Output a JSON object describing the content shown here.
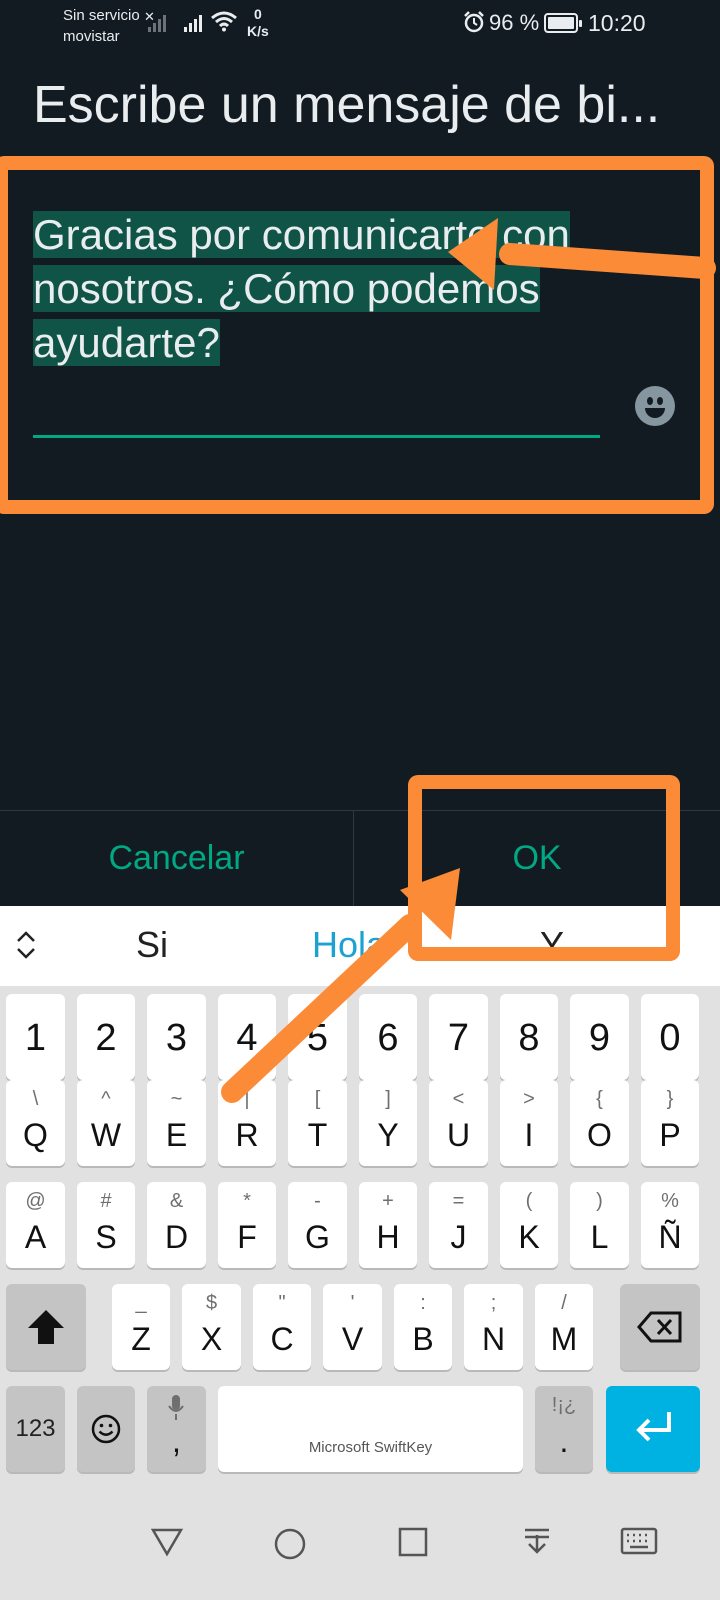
{
  "status_bar": {
    "carrier_line1": "Sin servicio",
    "carrier_line2": "movistar",
    "speed_value": "0",
    "speed_unit": "K/s",
    "battery_text": "96 %",
    "time": "10:20",
    "battery_level_percent": 96
  },
  "dialog": {
    "title": "Escribe un mensaje de bi...",
    "message_value": "Gracias por comunicarte con nosotros. ¿Cómo podemos ayudarte?",
    "cancel_label": "Cancelar",
    "ok_label": "OK"
  },
  "keyboard": {
    "suggestions": [
      "Si",
      "Hola",
      "Y"
    ],
    "number_row": [
      "1",
      "2",
      "3",
      "4",
      "5",
      "6",
      "7",
      "8",
      "9",
      "0"
    ],
    "row1": [
      {
        "main": "Q",
        "sec": "\\"
      },
      {
        "main": "W",
        "sec": "^"
      },
      {
        "main": "E",
        "sec": "~"
      },
      {
        "main": "R",
        "sec": "|"
      },
      {
        "main": "T",
        "sec": "["
      },
      {
        "main": "Y",
        "sec": "]"
      },
      {
        "main": "U",
        "sec": "<"
      },
      {
        "main": "I",
        "sec": ">"
      },
      {
        "main": "O",
        "sec": "{"
      },
      {
        "main": "P",
        "sec": "}"
      }
    ],
    "row2": [
      {
        "main": "A",
        "sec": "@"
      },
      {
        "main": "S",
        "sec": "#"
      },
      {
        "main": "D",
        "sec": "&"
      },
      {
        "main": "F",
        "sec": "*"
      },
      {
        "main": "G",
        "sec": "-"
      },
      {
        "main": "H",
        "sec": "+"
      },
      {
        "main": "J",
        "sec": "="
      },
      {
        "main": "K",
        "sec": "("
      },
      {
        "main": "L",
        "sec": ")"
      },
      {
        "main": "Ñ",
        "sec": "%"
      }
    ],
    "row3": [
      {
        "main": "Z",
        "sec": "_"
      },
      {
        "main": "X",
        "sec": "$"
      },
      {
        "main": "C",
        "sec": "\""
      },
      {
        "main": "V",
        "sec": "'"
      },
      {
        "main": "B",
        "sec": ":"
      },
      {
        "main": "N",
        "sec": ";"
      },
      {
        "main": "M",
        "sec": "/"
      }
    ],
    "numbers_key": "123",
    "comma_key": ",",
    "period_key": ".",
    "period_sec": "!¡¿",
    "spacebar_label": "Microsoft SwiftKey"
  },
  "colors": {
    "accent": "#00a884",
    "annotation": "#fb8b37",
    "selection": "#0f5446",
    "background": "#121b22",
    "enter_key": "#00b2e2"
  }
}
